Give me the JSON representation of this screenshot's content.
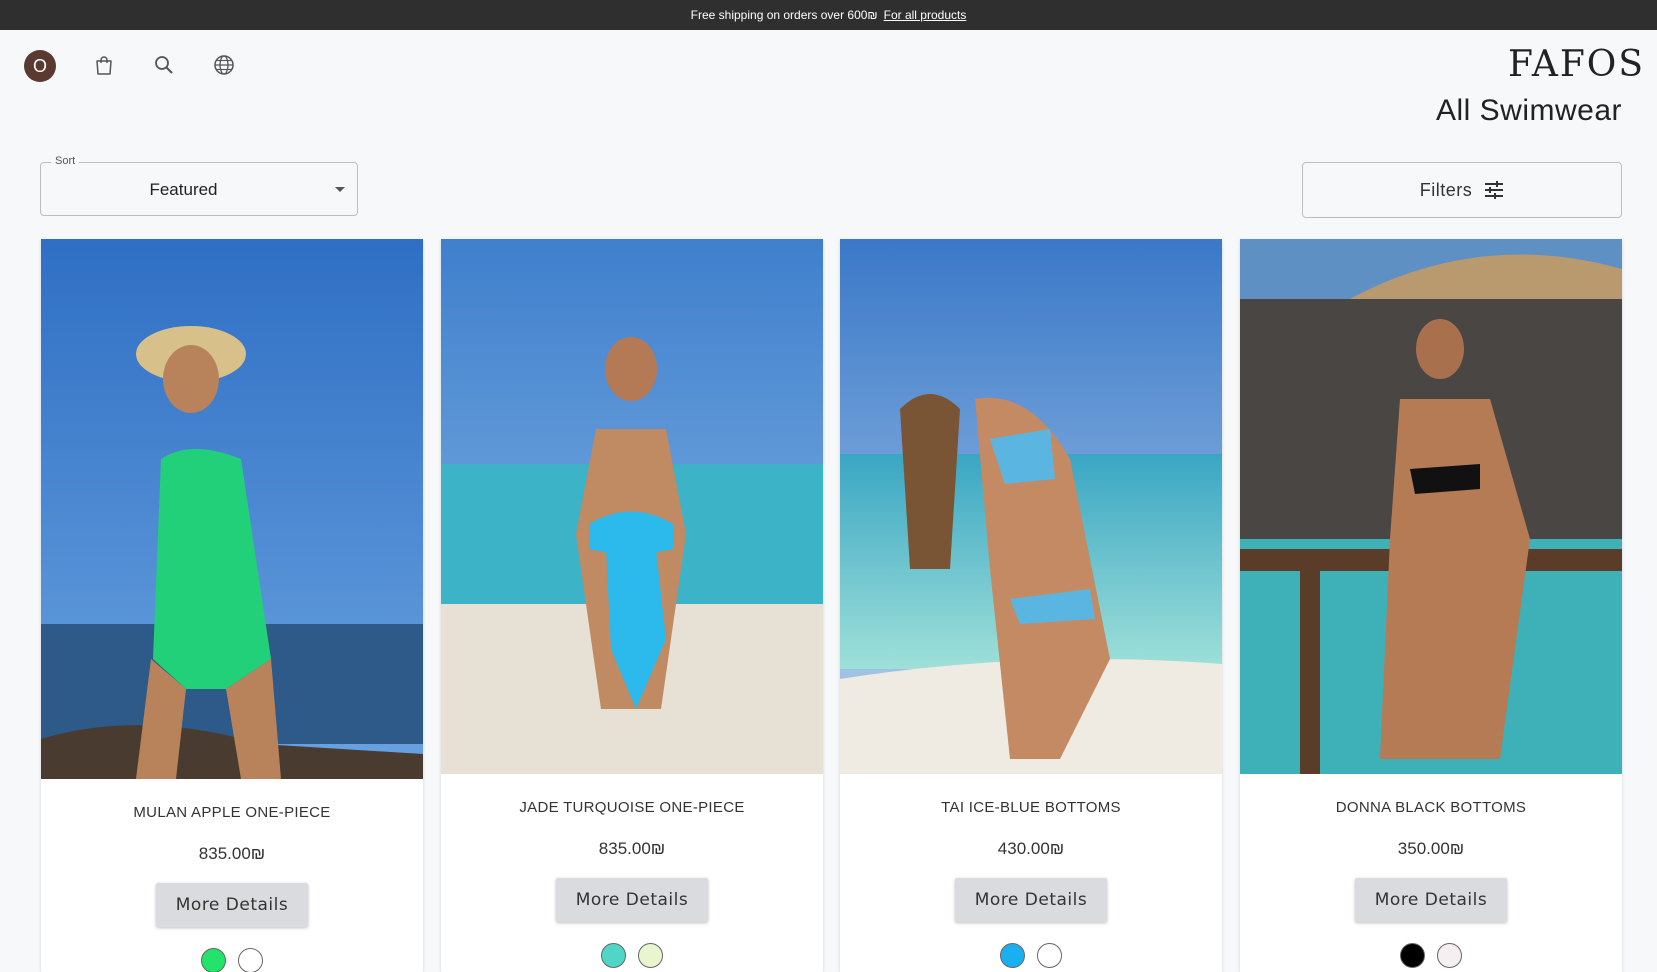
{
  "announcement": {
    "text": "Free shipping on orders over 600₪",
    "link": "For all products"
  },
  "header": {
    "avatar_letter": "O",
    "icons": [
      "shopping-bag-icon",
      "search-icon",
      "globe-icon"
    ],
    "logo": "FAFOS"
  },
  "page": {
    "title": "All Swimwear"
  },
  "sort": {
    "label": "Sort",
    "value": "Featured"
  },
  "filters": {
    "label": "Filters"
  },
  "products": [
    {
      "name": "MULAN APPLE ONE-PIECE",
      "price": "835.00₪",
      "button": "More Details",
      "swatches": [
        "#22e36b",
        "#ffffff"
      ]
    },
    {
      "name": "JADE TURQUOISE ONE-PIECE",
      "price": "835.00₪",
      "button": "More Details",
      "swatches": [
        "#4fd6c6",
        "#e9f5cf"
      ]
    },
    {
      "name": "TAI ICE-BLUE BOTTOMS",
      "price": "430.00₪",
      "button": "More Details",
      "swatches": [
        "#1ab0ef",
        "#ffffff"
      ]
    },
    {
      "name": "DONNA BLACK BOTTOMS",
      "price": "350.00₪",
      "button": "More Details",
      "swatches": [
        "#000000",
        "#f6eff1"
      ]
    }
  ]
}
